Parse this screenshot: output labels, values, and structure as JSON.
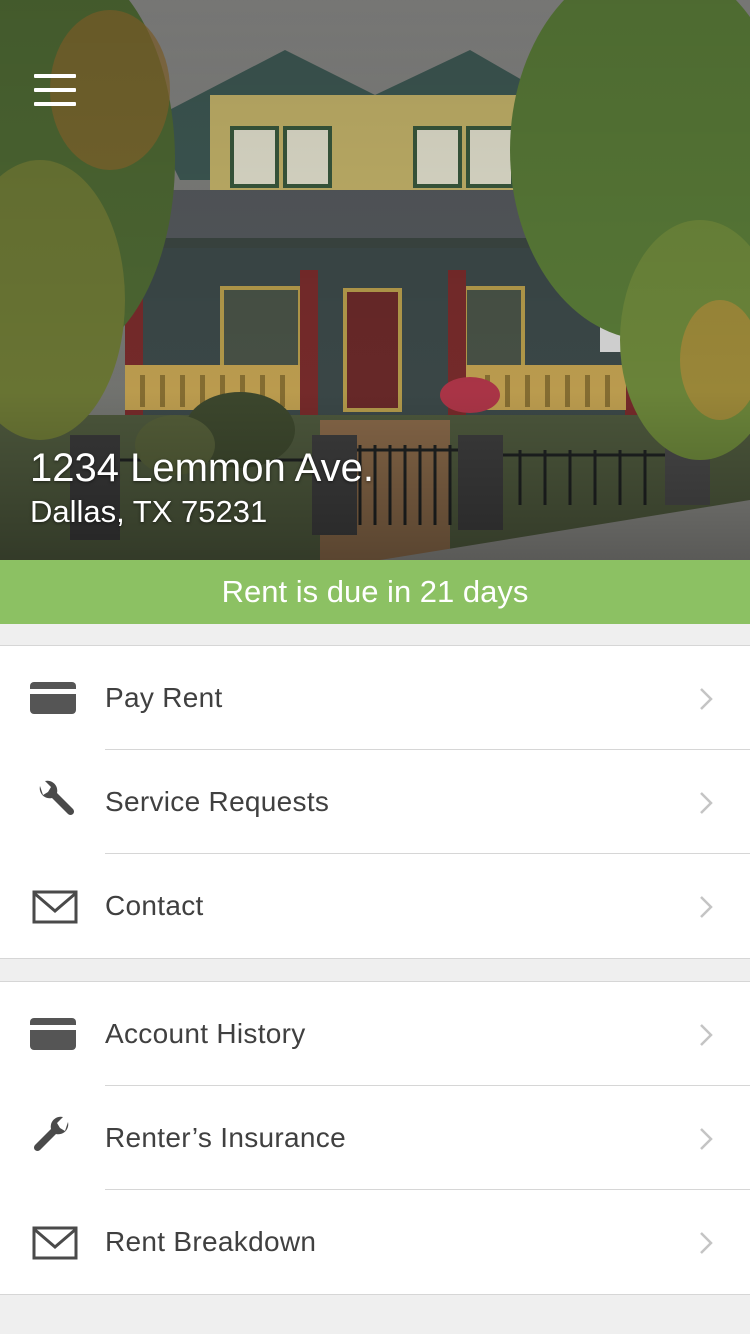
{
  "property": {
    "street": "1234 Lemmon Ave.",
    "city_line": "Dallas, TX 75231"
  },
  "banner": {
    "text": "Rent is due in 21 days",
    "color": "#8cc163"
  },
  "icons": {
    "menu": "hamburger-icon",
    "card": "credit-card-icon",
    "wrench": "wrench-icon",
    "mail": "envelope-icon",
    "chevron": "chevron-right-icon"
  },
  "menu_groups": [
    {
      "items": [
        {
          "label": "Pay Rent",
          "icon": "credit-card-icon"
        },
        {
          "label": "Service Requests",
          "icon": "wrench-icon"
        },
        {
          "label": "Contact",
          "icon": "envelope-icon"
        }
      ]
    },
    {
      "items": [
        {
          "label": "Account History",
          "icon": "credit-card-icon"
        },
        {
          "label": "Renter’s Insurance",
          "icon": "wrench-icon"
        },
        {
          "label": "Rent Breakdown",
          "icon": "envelope-icon"
        }
      ]
    }
  ]
}
